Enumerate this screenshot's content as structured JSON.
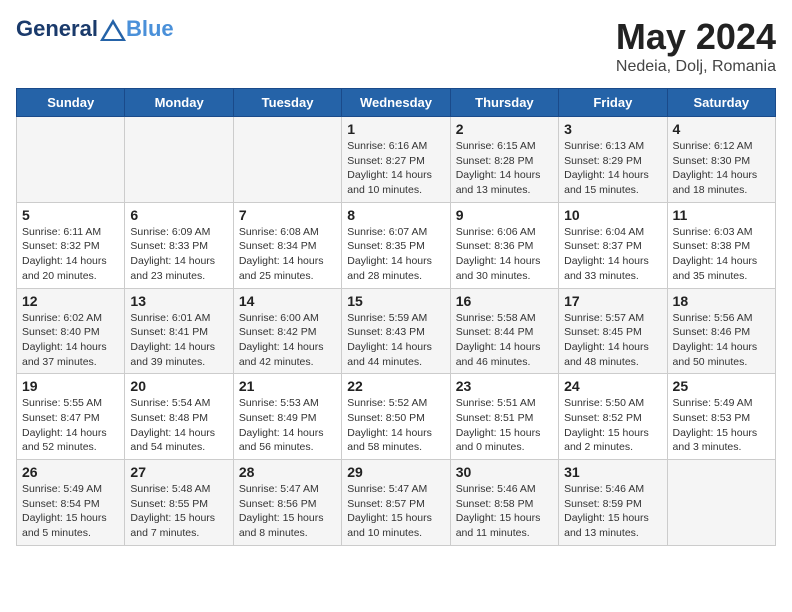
{
  "header": {
    "logo_line1": "General",
    "logo_line2": "Blue",
    "month": "May 2024",
    "location": "Nedeia, Dolj, Romania"
  },
  "weekdays": [
    "Sunday",
    "Monday",
    "Tuesday",
    "Wednesday",
    "Thursday",
    "Friday",
    "Saturday"
  ],
  "weeks": [
    [
      {
        "day": null,
        "info": null
      },
      {
        "day": null,
        "info": null
      },
      {
        "day": null,
        "info": null
      },
      {
        "day": "1",
        "info": "Sunrise: 6:16 AM\nSunset: 8:27 PM\nDaylight: 14 hours\nand 10 minutes."
      },
      {
        "day": "2",
        "info": "Sunrise: 6:15 AM\nSunset: 8:28 PM\nDaylight: 14 hours\nand 13 minutes."
      },
      {
        "day": "3",
        "info": "Sunrise: 6:13 AM\nSunset: 8:29 PM\nDaylight: 14 hours\nand 15 minutes."
      },
      {
        "day": "4",
        "info": "Sunrise: 6:12 AM\nSunset: 8:30 PM\nDaylight: 14 hours\nand 18 minutes."
      }
    ],
    [
      {
        "day": "5",
        "info": "Sunrise: 6:11 AM\nSunset: 8:32 PM\nDaylight: 14 hours\nand 20 minutes."
      },
      {
        "day": "6",
        "info": "Sunrise: 6:09 AM\nSunset: 8:33 PM\nDaylight: 14 hours\nand 23 minutes."
      },
      {
        "day": "7",
        "info": "Sunrise: 6:08 AM\nSunset: 8:34 PM\nDaylight: 14 hours\nand 25 minutes."
      },
      {
        "day": "8",
        "info": "Sunrise: 6:07 AM\nSunset: 8:35 PM\nDaylight: 14 hours\nand 28 minutes."
      },
      {
        "day": "9",
        "info": "Sunrise: 6:06 AM\nSunset: 8:36 PM\nDaylight: 14 hours\nand 30 minutes."
      },
      {
        "day": "10",
        "info": "Sunrise: 6:04 AM\nSunset: 8:37 PM\nDaylight: 14 hours\nand 33 minutes."
      },
      {
        "day": "11",
        "info": "Sunrise: 6:03 AM\nSunset: 8:38 PM\nDaylight: 14 hours\nand 35 minutes."
      }
    ],
    [
      {
        "day": "12",
        "info": "Sunrise: 6:02 AM\nSunset: 8:40 PM\nDaylight: 14 hours\nand 37 minutes."
      },
      {
        "day": "13",
        "info": "Sunrise: 6:01 AM\nSunset: 8:41 PM\nDaylight: 14 hours\nand 39 minutes."
      },
      {
        "day": "14",
        "info": "Sunrise: 6:00 AM\nSunset: 8:42 PM\nDaylight: 14 hours\nand 42 minutes."
      },
      {
        "day": "15",
        "info": "Sunrise: 5:59 AM\nSunset: 8:43 PM\nDaylight: 14 hours\nand 44 minutes."
      },
      {
        "day": "16",
        "info": "Sunrise: 5:58 AM\nSunset: 8:44 PM\nDaylight: 14 hours\nand 46 minutes."
      },
      {
        "day": "17",
        "info": "Sunrise: 5:57 AM\nSunset: 8:45 PM\nDaylight: 14 hours\nand 48 minutes."
      },
      {
        "day": "18",
        "info": "Sunrise: 5:56 AM\nSunset: 8:46 PM\nDaylight: 14 hours\nand 50 minutes."
      }
    ],
    [
      {
        "day": "19",
        "info": "Sunrise: 5:55 AM\nSunset: 8:47 PM\nDaylight: 14 hours\nand 52 minutes."
      },
      {
        "day": "20",
        "info": "Sunrise: 5:54 AM\nSunset: 8:48 PM\nDaylight: 14 hours\nand 54 minutes."
      },
      {
        "day": "21",
        "info": "Sunrise: 5:53 AM\nSunset: 8:49 PM\nDaylight: 14 hours\nand 56 minutes."
      },
      {
        "day": "22",
        "info": "Sunrise: 5:52 AM\nSunset: 8:50 PM\nDaylight: 14 hours\nand 58 minutes."
      },
      {
        "day": "23",
        "info": "Sunrise: 5:51 AM\nSunset: 8:51 PM\nDaylight: 15 hours\nand 0 minutes."
      },
      {
        "day": "24",
        "info": "Sunrise: 5:50 AM\nSunset: 8:52 PM\nDaylight: 15 hours\nand 2 minutes."
      },
      {
        "day": "25",
        "info": "Sunrise: 5:49 AM\nSunset: 8:53 PM\nDaylight: 15 hours\nand 3 minutes."
      }
    ],
    [
      {
        "day": "26",
        "info": "Sunrise: 5:49 AM\nSunset: 8:54 PM\nDaylight: 15 hours\nand 5 minutes."
      },
      {
        "day": "27",
        "info": "Sunrise: 5:48 AM\nSunset: 8:55 PM\nDaylight: 15 hours\nand 7 minutes."
      },
      {
        "day": "28",
        "info": "Sunrise: 5:47 AM\nSunset: 8:56 PM\nDaylight: 15 hours\nand 8 minutes."
      },
      {
        "day": "29",
        "info": "Sunrise: 5:47 AM\nSunset: 8:57 PM\nDaylight: 15 hours\nand 10 minutes."
      },
      {
        "day": "30",
        "info": "Sunrise: 5:46 AM\nSunset: 8:58 PM\nDaylight: 15 hours\nand 11 minutes."
      },
      {
        "day": "31",
        "info": "Sunrise: 5:46 AM\nSunset: 8:59 PM\nDaylight: 15 hours\nand 13 minutes."
      },
      {
        "day": null,
        "info": null
      }
    ]
  ]
}
